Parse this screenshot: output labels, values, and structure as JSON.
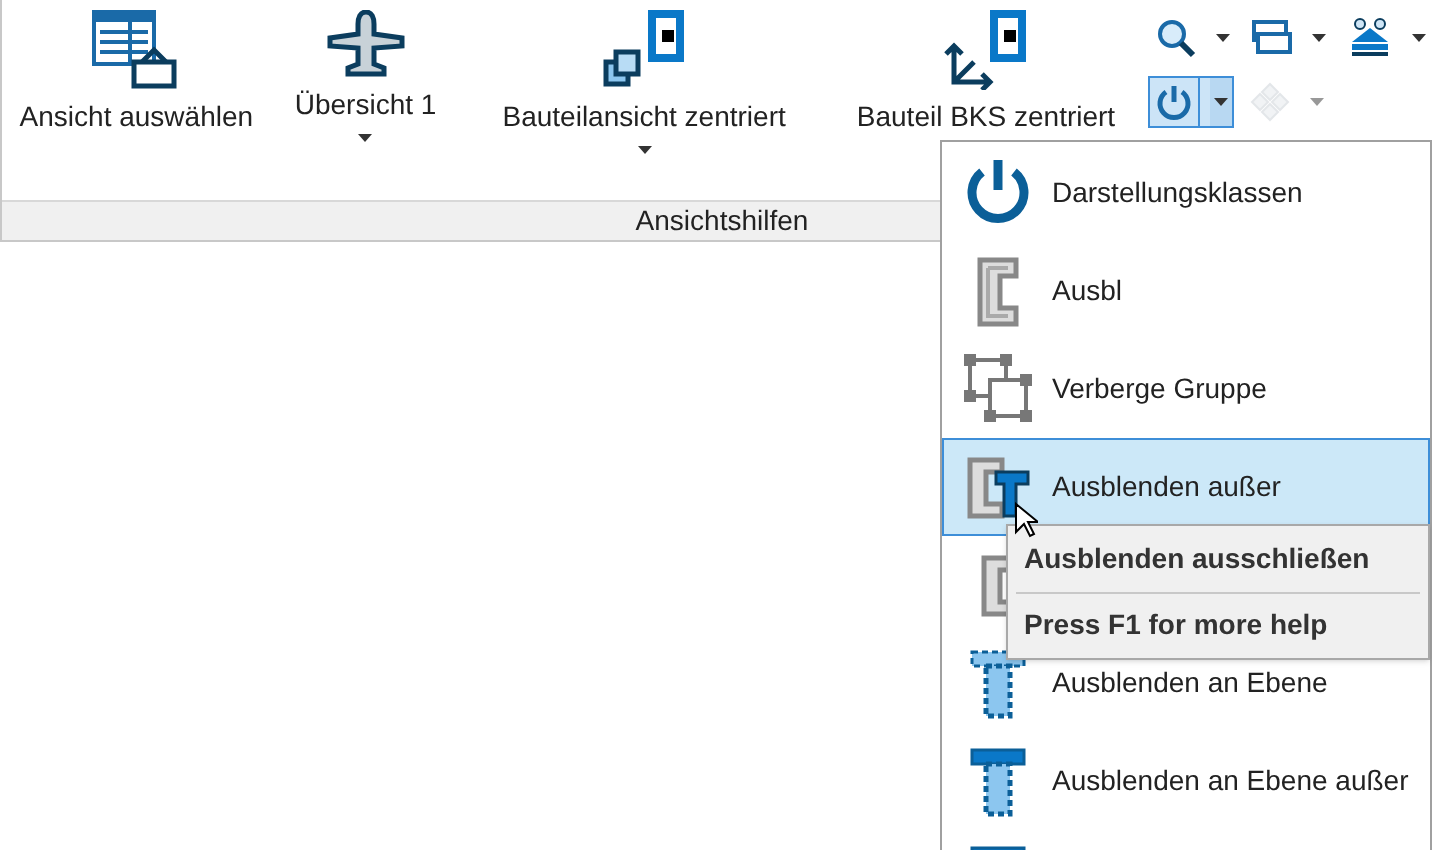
{
  "ribbon": {
    "buttons": [
      {
        "label": "Ansicht auswählen",
        "kind": "select-view",
        "dropdown": false
      },
      {
        "label": "Übersicht 1",
        "kind": "overview",
        "dropdown": true
      },
      {
        "label": "Bauteilansicht zentriert",
        "kind": "part-centered",
        "dropdown": true
      },
      {
        "label": "Bauteil BKS zentriert",
        "kind": "ucs-centered",
        "dropdown": false
      }
    ],
    "group_label": "Ansichtshilfen",
    "small_tools": [
      {
        "kind": "zoom",
        "selected": false,
        "disabled": false
      },
      {
        "kind": "windows",
        "selected": false,
        "disabled": false
      },
      {
        "kind": "stack",
        "selected": false,
        "disabled": false
      },
      {
        "kind": "power",
        "selected": true,
        "disabled": false
      },
      {
        "kind": "diamonds",
        "selected": false,
        "disabled": true
      }
    ]
  },
  "menu": {
    "items": [
      {
        "kind": "power",
        "label": "Darstellungsklassen",
        "selected": false
      },
      {
        "kind": "bracket",
        "label": "Ausbl",
        "selected": false
      },
      {
        "kind": "group",
        "label": "Verberge Gruppe",
        "selected": false
      },
      {
        "kind": "bracket-blue",
        "label": "Ausblenden außer",
        "selected": true
      },
      {
        "kind": "bracket-blue2",
        "selected": false
      },
      {
        "kind": "screw",
        "label": "Ausblenden an Ebene",
        "selected": false
      },
      {
        "kind": "screw-solid",
        "label": "Ausblenden an Ebene außer",
        "selected": false
      },
      {
        "kind": "screw-solid",
        "selected": false
      }
    ]
  },
  "tooltip": {
    "title": "Ausblenden ausschließen",
    "help": "Press F1 for more help"
  }
}
